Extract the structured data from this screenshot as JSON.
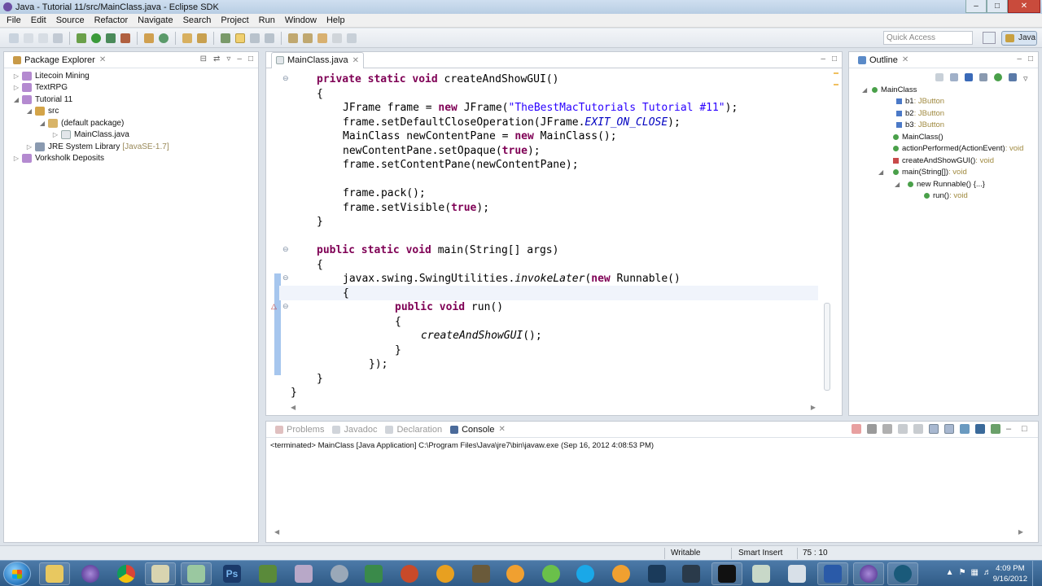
{
  "window": {
    "title": "Java - Tutorial 11/src/MainClass.java - Eclipse SDK"
  },
  "menu": [
    "File",
    "Edit",
    "Source",
    "Refactor",
    "Navigate",
    "Search",
    "Project",
    "Run",
    "Window",
    "Help"
  ],
  "toolbar": {
    "quick_access_placeholder": "Quick Access",
    "perspective_label": "Java"
  },
  "package_explorer": {
    "title": "Package Explorer",
    "tree": [
      {
        "label": "Litecoin Mining",
        "extra": ""
      },
      {
        "label": "TextRPG",
        "extra": ""
      },
      {
        "label": "Tutorial 11",
        "extra": ""
      },
      {
        "label": "src",
        "extra": ""
      },
      {
        "label": "(default package)",
        "extra": ""
      },
      {
        "label": "MainClass.java",
        "extra": ""
      },
      {
        "label": "JRE System Library",
        "extra": "[JavaSE-1.7]"
      },
      {
        "label": "Vorksholk Deposits",
        "extra": ""
      }
    ]
  },
  "editor": {
    "tab_label": "MainClass.java",
    "code": [
      "private static void createAndShowGUI()",
      "{",
      "JFrame frame = new JFrame(\"TheBestMacTutorials Tutorial #11\");",
      "frame.setDefaultCloseOperation(JFrame.EXIT_ON_CLOSE);",
      "MainClass newContentPane = new MainClass();",
      "newContentPane.setOpaque(true);",
      "frame.setContentPane(newContentPane);",
      "",
      "frame.pack();",
      "frame.setVisible(true);",
      "}",
      "",
      "public static void main(String[] args)",
      "{",
      "javax.swing.SwingUtilities.invokeLater(new Runnable()",
      "{",
      "public void run()",
      "{",
      "createAndShowGUI();",
      "}",
      "});",
      "}",
      "}"
    ]
  },
  "outline": {
    "title": "Outline",
    "items": [
      {
        "name": "MainClass",
        "type": ""
      },
      {
        "name": "b1",
        "type": " : JButton"
      },
      {
        "name": "b2",
        "type": " : JButton"
      },
      {
        "name": "b3",
        "type": " : JButton"
      },
      {
        "name": "MainClass()",
        "type": ""
      },
      {
        "name": "actionPerformed(ActionEvent)",
        "type": " : void"
      },
      {
        "name": "createAndShowGUI()",
        "type": " : void"
      },
      {
        "name": "main(String[])",
        "type": " : void"
      },
      {
        "name": "new Runnable() {...}",
        "type": ""
      },
      {
        "name": "run()",
        "type": " : void"
      }
    ]
  },
  "bottom_tabs": [
    "Problems",
    "Javadoc",
    "Declaration",
    "Console"
  ],
  "console": {
    "text": "<terminated> MainClass [Java Application] C:\\Program Files\\Java\\jre7\\bin\\javaw.exe (Sep 16, 2012 4:08:53 PM)"
  },
  "status": {
    "writable": "Writable",
    "insert_mode": "Smart Insert",
    "position": "75 : 10"
  },
  "taskbar": {
    "time": "4:09 PM",
    "date": "9/16/2012"
  },
  "colors": {
    "keyword": "#7f0055",
    "string": "#2a00ff",
    "constant": "#0000c0",
    "quick_diff": "#a6c6ee"
  }
}
